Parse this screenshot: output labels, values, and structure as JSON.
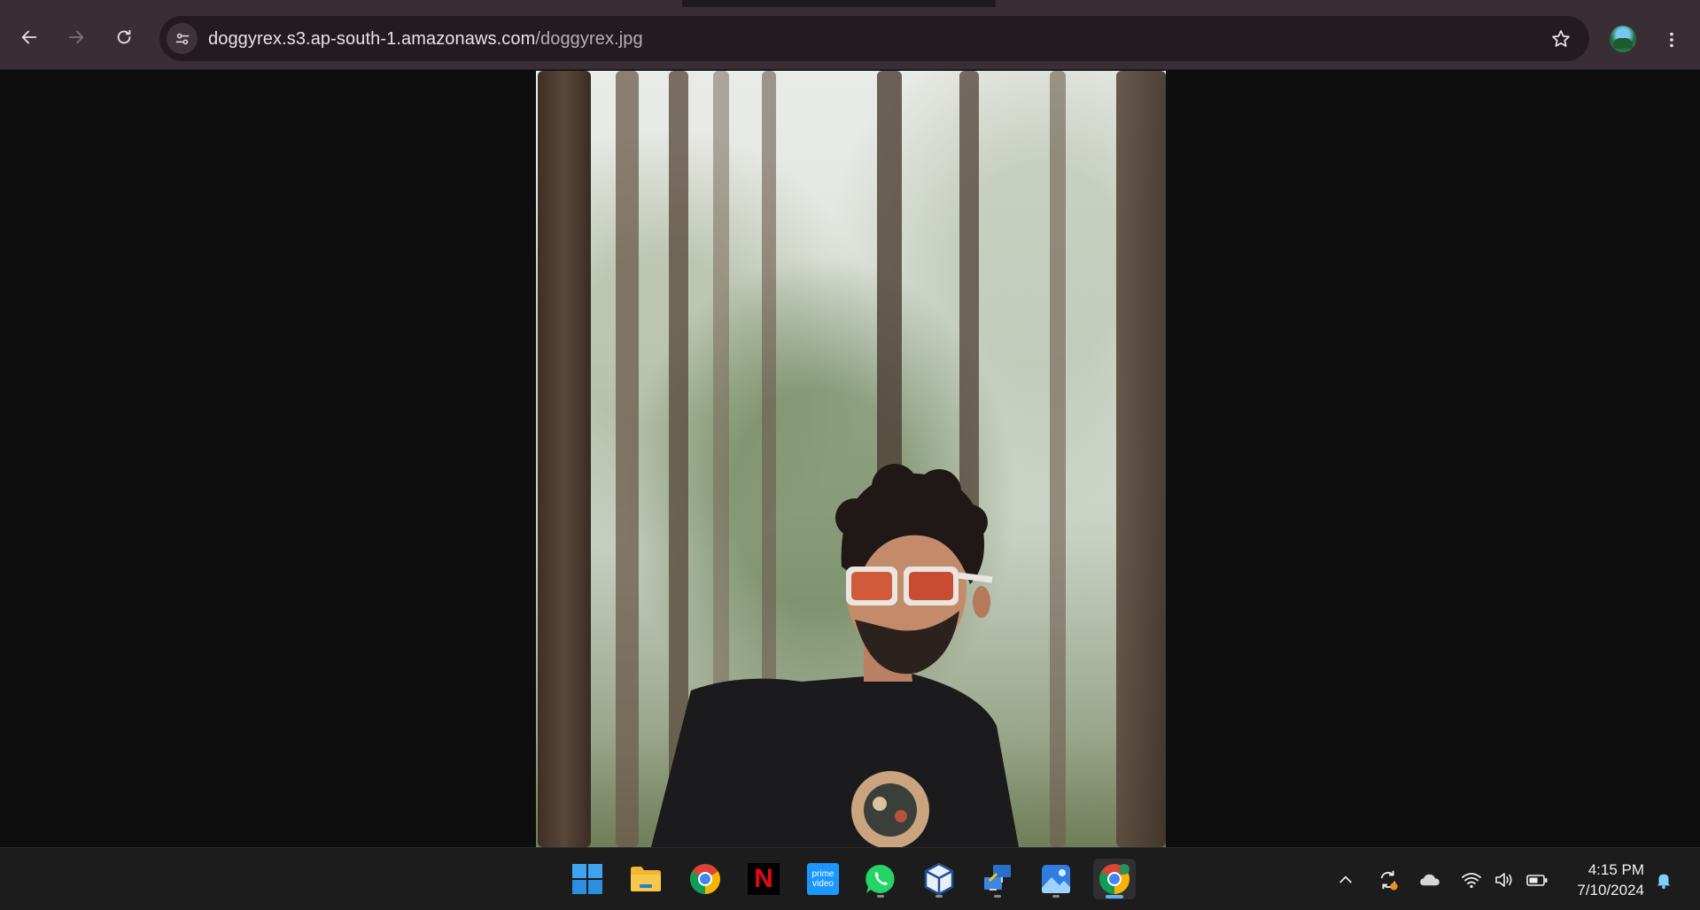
{
  "browser": {
    "url_host": "doggyrex.s3.ap-south-1.amazonaws.com",
    "url_path": "/doggyrex.jpg",
    "accent": "#3a2e36"
  },
  "taskbar": {
    "apps": [
      {
        "name": "start",
        "icon": "windows-logo-icon"
      },
      {
        "name": "file-explorer",
        "icon": "folder-icon"
      },
      {
        "name": "chrome",
        "icon": "chrome-icon"
      },
      {
        "name": "netflix",
        "icon": "netflix-icon"
      },
      {
        "name": "prime-video",
        "icon": "prime-video-icon",
        "label": "prime video"
      },
      {
        "name": "whatsapp",
        "icon": "whatsapp-icon"
      },
      {
        "name": "virtualbox",
        "icon": "virtualbox-icon"
      },
      {
        "name": "remote-desktop",
        "icon": "remote-desktop-icon"
      },
      {
        "name": "photos",
        "icon": "photos-icon"
      },
      {
        "name": "chrome-active",
        "icon": "chrome-icon"
      }
    ],
    "netflix_letter": "N",
    "prime_label_top": "prime",
    "prime_label_bottom": "video"
  },
  "clock": {
    "time": "4:15 PM",
    "date": "7/10/2024"
  }
}
